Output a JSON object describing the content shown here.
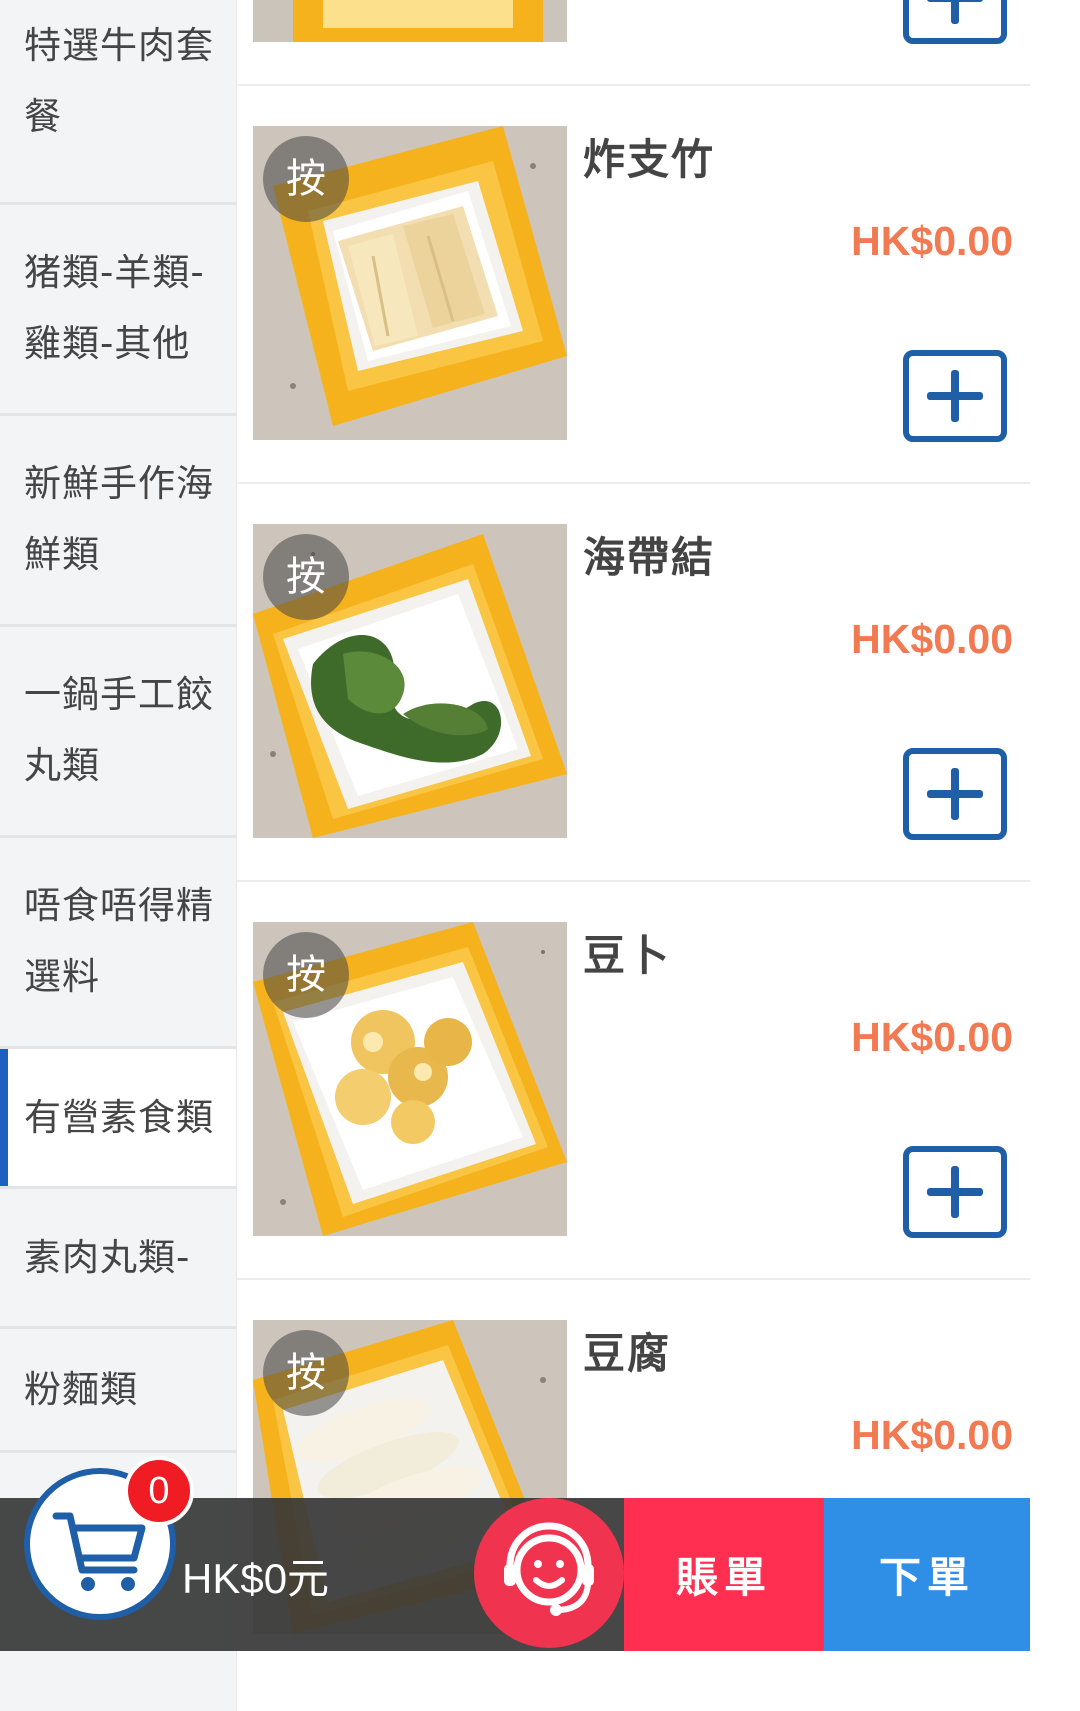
{
  "sidebar": {
    "categories": [
      {
        "label": "特選牛肉套餐",
        "active": false
      },
      {
        "label": "猪類-羊類-雞類-其他",
        "active": false
      },
      {
        "label": "新鮮手作海鮮類",
        "active": false
      },
      {
        "label": "一鍋手工餃丸類",
        "active": false
      },
      {
        "label": "唔食唔得精選料",
        "active": false
      },
      {
        "label": "有營素食類",
        "active": true
      },
      {
        "label": "素肉丸類-",
        "active": false
      },
      {
        "label": "粉麵類",
        "active": false
      }
    ]
  },
  "products": [
    {
      "name": "",
      "price": "",
      "badge": "按",
      "image": "yellow-crate-partial"
    },
    {
      "name": "炸支竹",
      "price": "HK$0.00",
      "badge": "按",
      "image": "fried-beancurd-sheet"
    },
    {
      "name": "海帶結",
      "price": "HK$0.00",
      "badge": "按",
      "image": "seaweed-knots"
    },
    {
      "name": "豆卜",
      "price": "HK$0.00",
      "badge": "按",
      "image": "tofu-puffs"
    },
    {
      "name": "豆腐",
      "price": "HK$0.00",
      "badge": "按",
      "image": "tofu-slices"
    }
  ],
  "cart": {
    "count": "0",
    "total": "HK$0元",
    "icon": "cart-icon"
  },
  "support": {
    "icon": "customer-service-headset-icon"
  },
  "actions": {
    "bill_label": "賬單",
    "order_label": "下單"
  },
  "colors": {
    "accent_blue": "#1f5fa8",
    "price_orange": "#f27a52",
    "bill_red": "#ff2f52",
    "order_blue": "#2f8ee5",
    "badge_red": "#ef1c24"
  }
}
